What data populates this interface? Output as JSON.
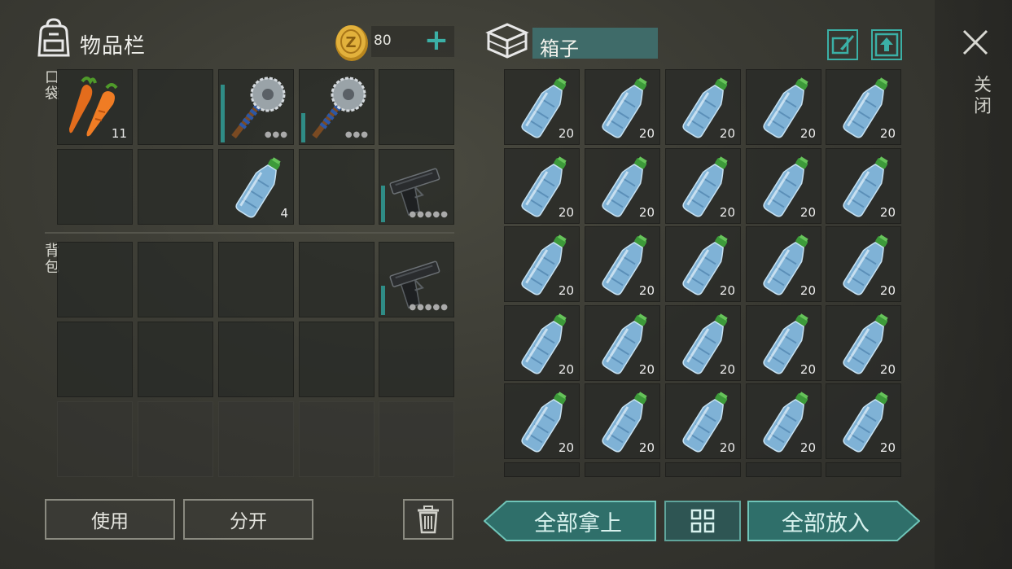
{
  "inventory": {
    "title": "物品栏",
    "coins": "80",
    "pocket_label": "口袋",
    "backpack_label": "背包",
    "pocket_slots": [
      {
        "item": "carrot",
        "qty": "11"
      },
      {
        "item": "empty"
      },
      {
        "item": "saw-mace",
        "durability": 0.8
      },
      {
        "item": "saw-mace",
        "durability": 0.4
      },
      {
        "item": "empty"
      },
      {
        "item": "empty"
      },
      {
        "item": "empty"
      },
      {
        "item": "water-bottle",
        "qty": "4"
      },
      {
        "item": "empty"
      },
      {
        "item": "pistol",
        "durability": 0.5
      }
    ],
    "backpack_slots": [
      {
        "item": "empty"
      },
      {
        "item": "empty"
      },
      {
        "item": "empty"
      },
      {
        "item": "empty"
      },
      {
        "item": "pistol",
        "durability": 0.4
      }
    ]
  },
  "box": {
    "title": "箱子",
    "slot_qty": "20",
    "slot_item": "water-bottle"
  },
  "close_label": "关闭",
  "buttons": {
    "use": "使用",
    "split": "分开",
    "take_all": "全部拿上",
    "put_all": "全部放入"
  },
  "colors": {
    "accent": "#3bb0a6",
    "box_title_bg": "#3f6b69",
    "slot_bg": "#2a2c28"
  }
}
